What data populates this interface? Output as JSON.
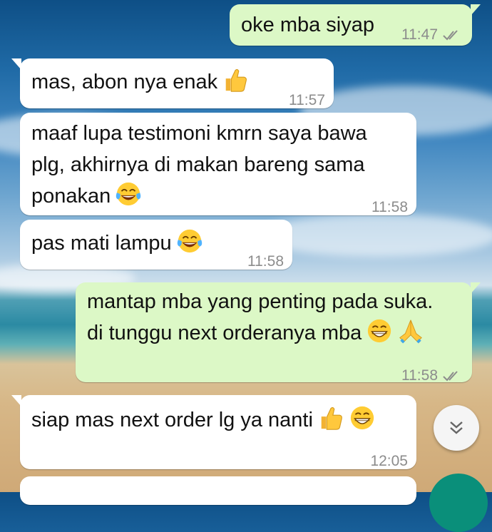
{
  "chat": {
    "messages": [
      {
        "direction": "outgoing",
        "text": "oke mba siyap",
        "time": "11:47",
        "status": "read"
      },
      {
        "direction": "incoming",
        "text": "mas, abon nya enak",
        "emoji": [
          "thumbs-up"
        ],
        "time": "11:57"
      },
      {
        "direction": "incoming",
        "lines": [
          "maaf lupa testimoni kmrn saya bawa",
          "plg, akhirnya di makan bareng sama",
          "ponakan"
        ],
        "emoji": [
          "face-with-tears-of-joy"
        ],
        "time": "11:58"
      },
      {
        "direction": "incoming",
        "text": "pas mati lampu",
        "emoji": [
          "face-with-tears-of-joy"
        ],
        "time": "11:58"
      },
      {
        "direction": "outgoing",
        "lines": [
          "mantap mba yang penting pada suka.",
          "di tunggu next orderanya mba"
        ],
        "emoji": [
          "grinning-face-with-smiling-eyes",
          "folded-hands"
        ],
        "time": "11:58",
        "status": "read"
      },
      {
        "direction": "incoming",
        "text": "siap mas next order lg ya nanti",
        "emoji": [
          "thumbs-up",
          "grinning-face-with-smiling-eyes"
        ],
        "time": "12:05"
      }
    ]
  },
  "controls": {
    "scroll_down_icon": "double-chevron-down-icon",
    "compose_fab_icon": "compose-icon"
  },
  "colors": {
    "incoming_bubble": "#ffffff",
    "outgoing_bubble": "#dcf8c6",
    "timestamp": "#8c8c8c",
    "read_check": "#8c8c8c",
    "fab": "#0a8f7a"
  }
}
